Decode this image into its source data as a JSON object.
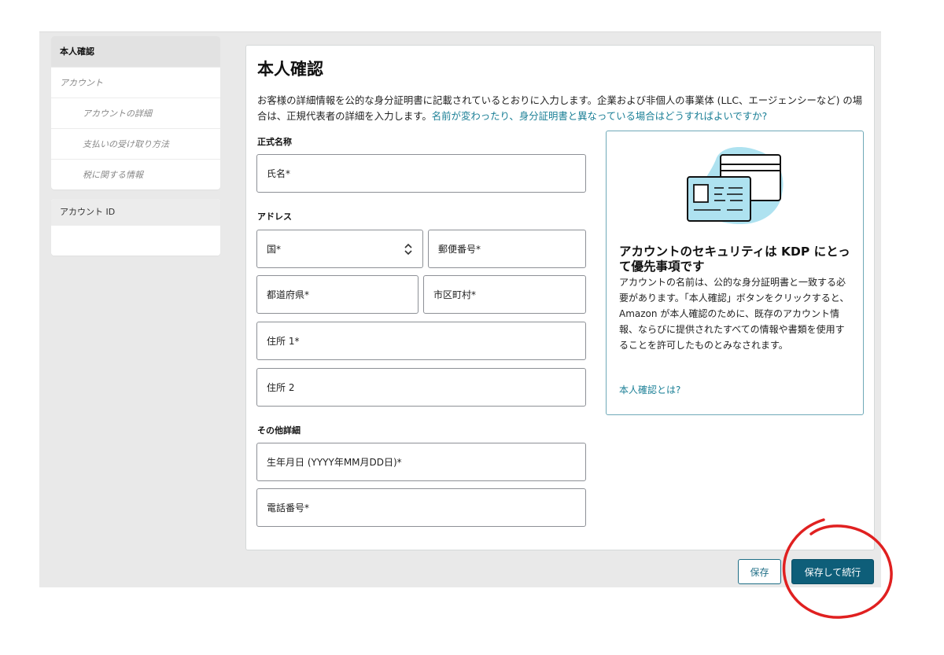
{
  "sidebar": {
    "section1": {
      "header": "本人確認",
      "items": [
        {
          "label": "アカウント",
          "level": 1
        },
        {
          "label": "アカウントの詳細",
          "level": 2
        },
        {
          "label": "支払いの受け取り方法",
          "level": 2
        },
        {
          "label": "税に関する情報",
          "level": 2
        }
      ]
    },
    "section2": {
      "header": "アカウント ID"
    }
  },
  "main": {
    "title": "本人確認",
    "intro_text": "お客様の詳細情報を公的な身分証明書に記載されているとおりに入力します。企業および非個人の事業体 (LLC、エージェンシーなど) の場合は、正規代表者の詳細を入力します。",
    "intro_link": "名前が変わったり、身分証明書と異なっている場合はどうすればよいですか?",
    "sections": {
      "legal_name": "正式名称",
      "address": "アドレス",
      "other": "その他詳細"
    },
    "fields": {
      "full_name": "氏名*",
      "country": "国*",
      "postal_code": "郵便番号*",
      "prefecture": "都道府県*",
      "city": "市区町村*",
      "address1": "住所 1*",
      "address2": "住所 2",
      "birthdate": "生年月日 (YYYY年MM月DD日)*",
      "phone": "電話番号*"
    }
  },
  "info_card": {
    "title": "アカウントのセキュリティは KDP にとって優先事項です",
    "body": "アカウントの名前は、公的な身分証明書と一致する必要があります。「本人確認」ボタンをクリックすると、Amazon が本人確認のために、既存のアカウント情報、ならびに提供されたすべての情報や書類を使用することを許可したものとみなされます。",
    "link": "本人確認とは?"
  },
  "buttons": {
    "save": "保存",
    "save_continue": "保存して続行"
  },
  "icons": {
    "id_card": "id-card-illustration-icon",
    "select_arrows": "chevron-up-down-icon"
  },
  "colors": {
    "link": "#1a7f96",
    "primary_button": "#0e5e79",
    "annotation": "#e02020",
    "illustration_bg": "#aee2f0"
  }
}
